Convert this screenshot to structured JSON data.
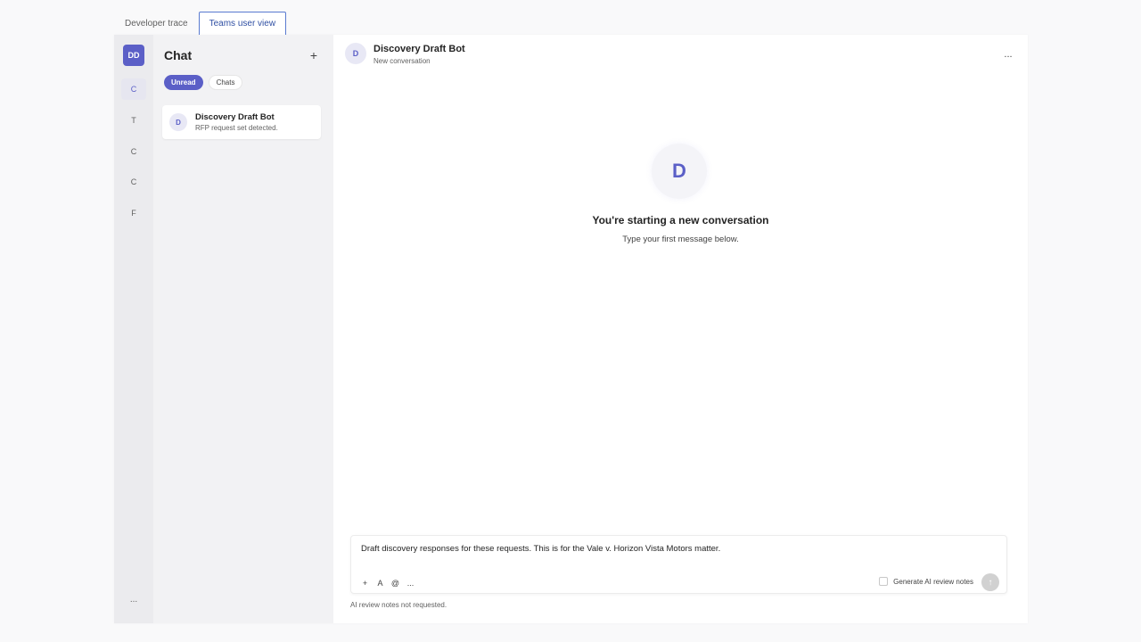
{
  "top_tabs": [
    {
      "label": "Developer trace",
      "active": false
    },
    {
      "label": "Teams user view",
      "active": true
    }
  ],
  "rail": {
    "avatar_initials": "DD",
    "items": [
      {
        "label": "C",
        "active": true
      },
      {
        "label": "T",
        "active": false
      },
      {
        "label": "C",
        "active": false
      },
      {
        "label": "C",
        "active": false
      },
      {
        "label": "F",
        "active": false
      }
    ],
    "more_label": "..."
  },
  "chat_list": {
    "title": "Chat",
    "new_chat_icon": "plus-icon",
    "new_chat_glyph": "+",
    "filters": [
      {
        "label": "Unread",
        "active": true
      },
      {
        "label": "Chats",
        "active": false
      }
    ],
    "items": [
      {
        "initial": "D",
        "name": "Discovery Draft Bot",
        "preview": "RFP request set detected."
      }
    ]
  },
  "conversation": {
    "header": {
      "initial": "D",
      "name": "Discovery Draft Bot",
      "subtitle": "New conversation",
      "more_icon": "more-horizontal-icon",
      "more_glyph": "..."
    },
    "empty_state": {
      "initial": "D",
      "title": "You're starting a new conversation",
      "subtitle": "Type your first message below."
    },
    "composer": {
      "value": "Draft discovery responses for these requests. This is for the Vale v. Horizon Vista Motors matter.",
      "tools": [
        {
          "icon": "attach-plus-icon",
          "glyph": "+"
        },
        {
          "icon": "format-text-icon",
          "glyph": "A"
        },
        {
          "icon": "mention-icon",
          "glyph": "@"
        },
        {
          "icon": "more-options-icon",
          "glyph": "..."
        }
      ],
      "review_toggle_label": "Generate AI review notes",
      "review_checked": false,
      "send_icon": "send-arrow-icon",
      "send_glyph": "↑",
      "status_text": "AI review notes not requested."
    }
  },
  "colors": {
    "brand": "#5b5fc7",
    "active_tab_border": "#5a7bd0",
    "active_tab_text": "#2f4fa3"
  }
}
